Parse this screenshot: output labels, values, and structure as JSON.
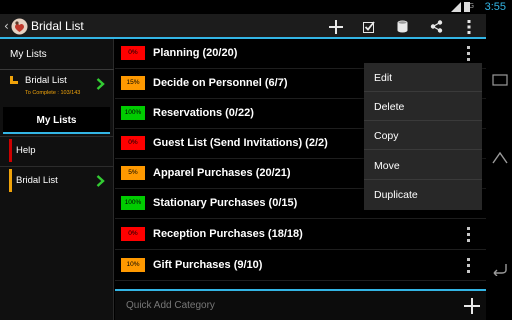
{
  "status": {
    "signal_label": "3G",
    "clock": "3:55"
  },
  "actionbar": {
    "title": "Bridal List",
    "icons": [
      "back-caret-icon",
      "bridal-app-icon",
      "add-icon",
      "checklist-icon",
      "database-icon",
      "share-icon",
      "overflow-menu-icon"
    ]
  },
  "sidebar": {
    "heading": "My Lists",
    "current_list": {
      "name": "Bridal List",
      "progress": "To Complete : 103/143"
    },
    "tab_label": "My Lists",
    "items": [
      {
        "label": "Help",
        "color": "#cc0000"
      },
      {
        "label": "Bridal List",
        "color": "#f0a30a"
      }
    ]
  },
  "categories": [
    {
      "percent": "0%",
      "name": "Planning (20/20)",
      "color": "#ff0000"
    },
    {
      "percent": "15%",
      "name": "Decide on Personnel (6/7)",
      "color": "#ff9900"
    },
    {
      "percent": "100%",
      "name": "Reservations (0/22)",
      "color": "#00cc00"
    },
    {
      "percent": "0%",
      "name": "Guest List (Send Invitations) (2/2)",
      "color": "#ff0000"
    },
    {
      "percent": "5%",
      "name": "Apparel Purchases (20/21)",
      "color": "#ff9900"
    },
    {
      "percent": "100%",
      "name": "Stationary Purchases (0/15)",
      "color": "#00cc00"
    },
    {
      "percent": "0%",
      "name": "Reception Purchases (18/18)",
      "color": "#ff0000"
    },
    {
      "percent": "10%",
      "name": "Gift Purchases (9/10)",
      "color": "#ff9900"
    }
  ],
  "popup_menu": [
    "Edit",
    "Delete",
    "Copy",
    "Move",
    "Duplicate"
  ],
  "quick_add": {
    "placeholder": "Quick Add Category"
  },
  "colors": {
    "accent": "#33b5e5",
    "actionbar": "#1c1c1c",
    "popup": "#282828"
  }
}
